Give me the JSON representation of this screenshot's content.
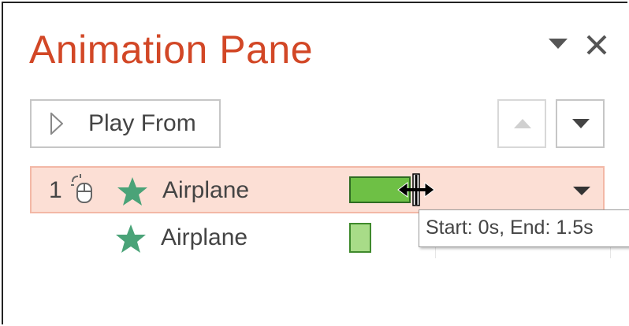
{
  "pane": {
    "title": "Animation Pane"
  },
  "toolbar": {
    "play_label": "Play From"
  },
  "animations": [
    {
      "order": "1",
      "trigger_icon": "mouse-click-icon",
      "effect_icon": "star-icon",
      "label": "Airplane",
      "bar_color": "#6ec045",
      "selected": true
    },
    {
      "order": "",
      "trigger_icon": "",
      "effect_icon": "star-icon",
      "label": "Airplane",
      "bar_color": "#a8dc88",
      "selected": false
    }
  ],
  "tooltip": {
    "text": "Start: 0s, End: 1.5s"
  },
  "colors": {
    "title": "#d24726",
    "selected_row_bg": "#fcdfd5",
    "star": "#4aa378"
  }
}
